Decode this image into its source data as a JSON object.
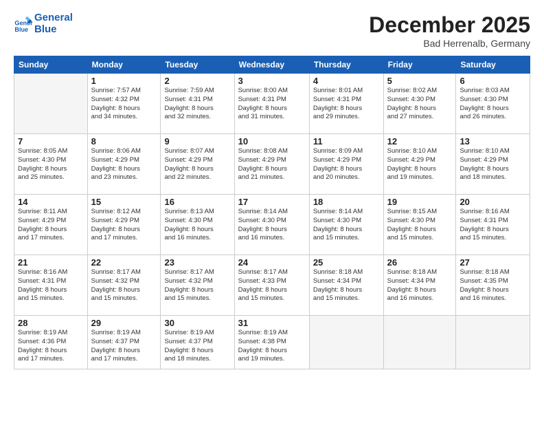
{
  "header": {
    "logo_line1": "General",
    "logo_line2": "Blue",
    "month": "December 2025",
    "location": "Bad Herrenalb, Germany"
  },
  "weekdays": [
    "Sunday",
    "Monday",
    "Tuesday",
    "Wednesday",
    "Thursday",
    "Friday",
    "Saturday"
  ],
  "weeks": [
    [
      {
        "num": "",
        "info": ""
      },
      {
        "num": "1",
        "info": "Sunrise: 7:57 AM\nSunset: 4:32 PM\nDaylight: 8 hours\nand 34 minutes."
      },
      {
        "num": "2",
        "info": "Sunrise: 7:59 AM\nSunset: 4:31 PM\nDaylight: 8 hours\nand 32 minutes."
      },
      {
        "num": "3",
        "info": "Sunrise: 8:00 AM\nSunset: 4:31 PM\nDaylight: 8 hours\nand 31 minutes."
      },
      {
        "num": "4",
        "info": "Sunrise: 8:01 AM\nSunset: 4:31 PM\nDaylight: 8 hours\nand 29 minutes."
      },
      {
        "num": "5",
        "info": "Sunrise: 8:02 AM\nSunset: 4:30 PM\nDaylight: 8 hours\nand 27 minutes."
      },
      {
        "num": "6",
        "info": "Sunrise: 8:03 AM\nSunset: 4:30 PM\nDaylight: 8 hours\nand 26 minutes."
      }
    ],
    [
      {
        "num": "7",
        "info": "Sunrise: 8:05 AM\nSunset: 4:30 PM\nDaylight: 8 hours\nand 25 minutes."
      },
      {
        "num": "8",
        "info": "Sunrise: 8:06 AM\nSunset: 4:29 PM\nDaylight: 8 hours\nand 23 minutes."
      },
      {
        "num": "9",
        "info": "Sunrise: 8:07 AM\nSunset: 4:29 PM\nDaylight: 8 hours\nand 22 minutes."
      },
      {
        "num": "10",
        "info": "Sunrise: 8:08 AM\nSunset: 4:29 PM\nDaylight: 8 hours\nand 21 minutes."
      },
      {
        "num": "11",
        "info": "Sunrise: 8:09 AM\nSunset: 4:29 PM\nDaylight: 8 hours\nand 20 minutes."
      },
      {
        "num": "12",
        "info": "Sunrise: 8:10 AM\nSunset: 4:29 PM\nDaylight: 8 hours\nand 19 minutes."
      },
      {
        "num": "13",
        "info": "Sunrise: 8:10 AM\nSunset: 4:29 PM\nDaylight: 8 hours\nand 18 minutes."
      }
    ],
    [
      {
        "num": "14",
        "info": "Sunrise: 8:11 AM\nSunset: 4:29 PM\nDaylight: 8 hours\nand 17 minutes."
      },
      {
        "num": "15",
        "info": "Sunrise: 8:12 AM\nSunset: 4:29 PM\nDaylight: 8 hours\nand 17 minutes."
      },
      {
        "num": "16",
        "info": "Sunrise: 8:13 AM\nSunset: 4:30 PM\nDaylight: 8 hours\nand 16 minutes."
      },
      {
        "num": "17",
        "info": "Sunrise: 8:14 AM\nSunset: 4:30 PM\nDaylight: 8 hours\nand 16 minutes."
      },
      {
        "num": "18",
        "info": "Sunrise: 8:14 AM\nSunset: 4:30 PM\nDaylight: 8 hours\nand 15 minutes."
      },
      {
        "num": "19",
        "info": "Sunrise: 8:15 AM\nSunset: 4:30 PM\nDaylight: 8 hours\nand 15 minutes."
      },
      {
        "num": "20",
        "info": "Sunrise: 8:16 AM\nSunset: 4:31 PM\nDaylight: 8 hours\nand 15 minutes."
      }
    ],
    [
      {
        "num": "21",
        "info": "Sunrise: 8:16 AM\nSunset: 4:31 PM\nDaylight: 8 hours\nand 15 minutes."
      },
      {
        "num": "22",
        "info": "Sunrise: 8:17 AM\nSunset: 4:32 PM\nDaylight: 8 hours\nand 15 minutes."
      },
      {
        "num": "23",
        "info": "Sunrise: 8:17 AM\nSunset: 4:32 PM\nDaylight: 8 hours\nand 15 minutes."
      },
      {
        "num": "24",
        "info": "Sunrise: 8:17 AM\nSunset: 4:33 PM\nDaylight: 8 hours\nand 15 minutes."
      },
      {
        "num": "25",
        "info": "Sunrise: 8:18 AM\nSunset: 4:34 PM\nDaylight: 8 hours\nand 15 minutes."
      },
      {
        "num": "26",
        "info": "Sunrise: 8:18 AM\nSunset: 4:34 PM\nDaylight: 8 hours\nand 16 minutes."
      },
      {
        "num": "27",
        "info": "Sunrise: 8:18 AM\nSunset: 4:35 PM\nDaylight: 8 hours\nand 16 minutes."
      }
    ],
    [
      {
        "num": "28",
        "info": "Sunrise: 8:19 AM\nSunset: 4:36 PM\nDaylight: 8 hours\nand 17 minutes."
      },
      {
        "num": "29",
        "info": "Sunrise: 8:19 AM\nSunset: 4:37 PM\nDaylight: 8 hours\nand 17 minutes."
      },
      {
        "num": "30",
        "info": "Sunrise: 8:19 AM\nSunset: 4:37 PM\nDaylight: 8 hours\nand 18 minutes."
      },
      {
        "num": "31",
        "info": "Sunrise: 8:19 AM\nSunset: 4:38 PM\nDaylight: 8 hours\nand 19 minutes."
      },
      {
        "num": "",
        "info": ""
      },
      {
        "num": "",
        "info": ""
      },
      {
        "num": "",
        "info": ""
      }
    ]
  ]
}
